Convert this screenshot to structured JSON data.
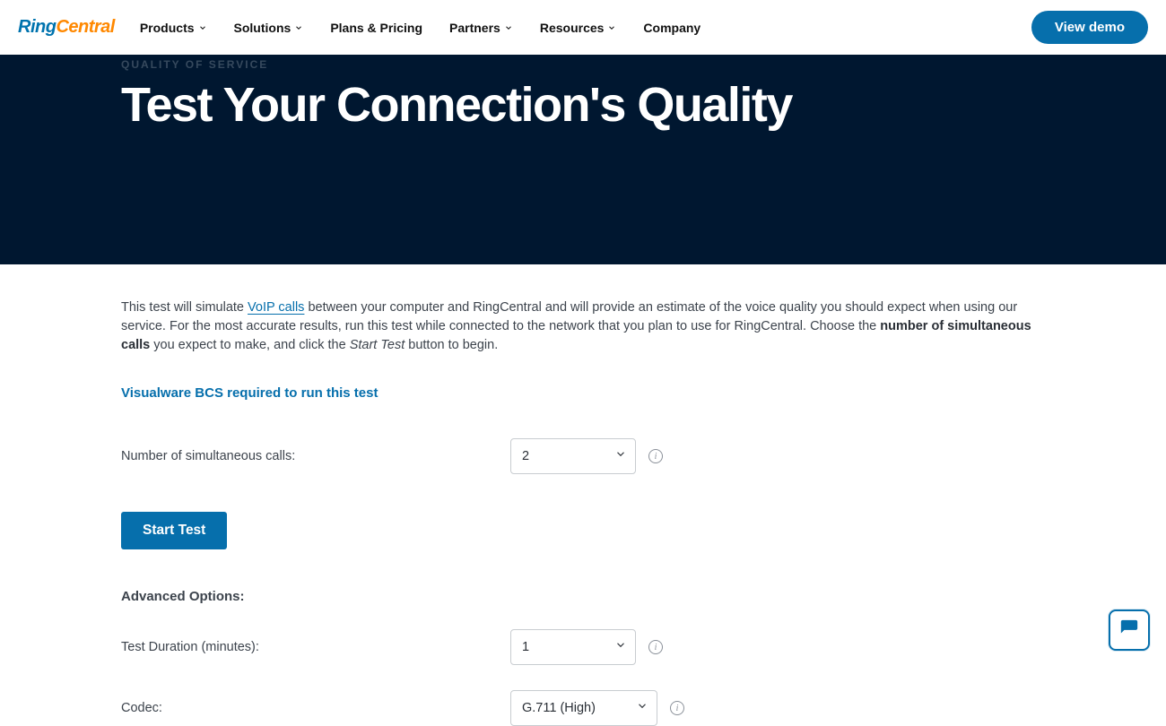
{
  "brand": {
    "part1": "Ring",
    "part2": "Central"
  },
  "nav": {
    "items": [
      {
        "label": "Products",
        "hasMenu": true
      },
      {
        "label": "Solutions",
        "hasMenu": true
      },
      {
        "label": "Plans & Pricing",
        "hasMenu": false
      },
      {
        "label": "Partners",
        "hasMenu": true
      },
      {
        "label": "Resources",
        "hasMenu": true
      },
      {
        "label": "Company",
        "hasMenu": false
      }
    ],
    "cta": "View demo"
  },
  "hero": {
    "eyebrow": "QUALITY OF SERVICE",
    "title": "Test Your Connection's Quality"
  },
  "intro": {
    "pre": "This test will simulate ",
    "link": "VoIP calls",
    "mid1": " between your computer and RingCentral and will provide an estimate of the voice quality you should expect when using our service. For the most accurate results, run this test while connected to the network that you plan to use for RingCentral. Choose the ",
    "bold": "number of simultaneous calls",
    "mid2": " you expect to make, and click the ",
    "italic": "Start Test",
    "post": " button to begin."
  },
  "requirement_link": "Visualware BCS required to run this test",
  "form": {
    "calls_label": "Number of simultaneous calls:",
    "calls_value": "2",
    "start_label": "Start Test",
    "advanced_heading": "Advanced Options:",
    "duration_label": "Test Duration (minutes):",
    "duration_value": "1",
    "codec_label": "Codec:",
    "codec_value": "G.711 (High)"
  }
}
